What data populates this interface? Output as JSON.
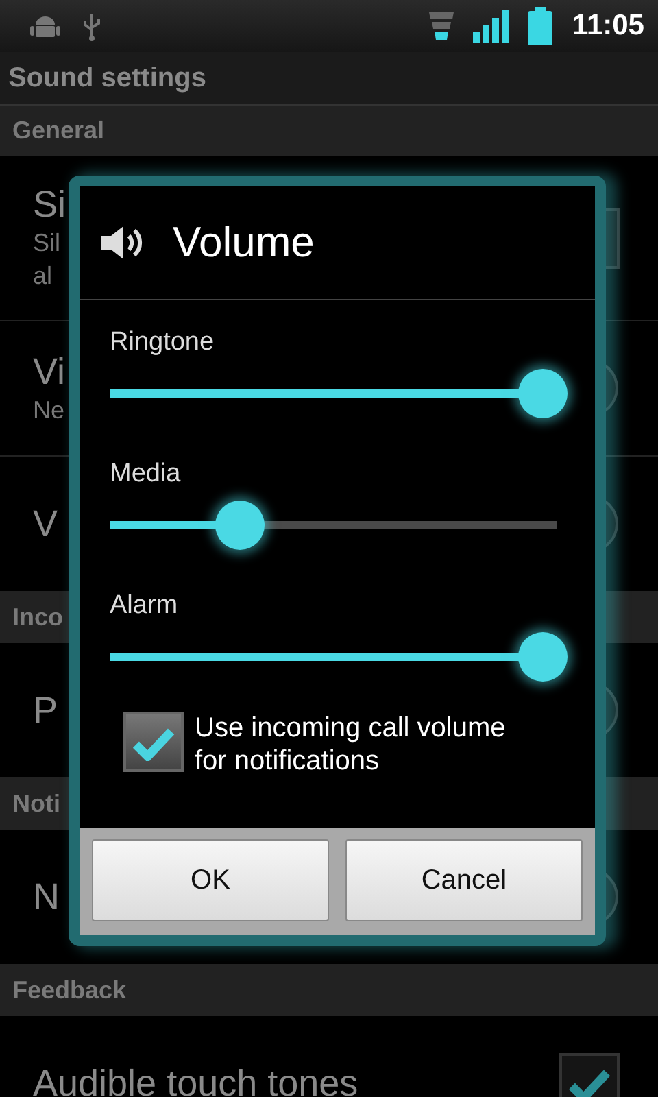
{
  "status_bar": {
    "time": "11:05"
  },
  "title": "Sound settings",
  "sections": [
    {
      "header": "General",
      "items": [
        {
          "kind": "checkbox",
          "title": "Si",
          "summary": "Sil",
          "summary_2": "al",
          "checked": false
        },
        {
          "kind": "list",
          "title": "Vi",
          "summary": "Ne"
        },
        {
          "kind": "list",
          "title": "V"
        }
      ]
    },
    {
      "header": "Inco",
      "items": [
        {
          "kind": "list",
          "title": "P"
        }
      ]
    },
    {
      "header": "Noti",
      "items": [
        {
          "kind": "list",
          "title": "N"
        }
      ]
    },
    {
      "header": "Feedback",
      "items": [
        {
          "kind": "checkbox",
          "title": "Audible touch tones",
          "checked": true
        }
      ]
    }
  ],
  "dialog": {
    "title": "Volume",
    "sliders": [
      {
        "label": "Ringtone",
        "level": 0.97
      },
      {
        "label": "Media",
        "level": 0.29
      },
      {
        "label": "Alarm",
        "level": 0.97
      }
    ],
    "checkbox": {
      "label": "Use incoming call volume for notifications",
      "checked": true
    },
    "buttons": [
      "OK",
      "Cancel"
    ]
  }
}
